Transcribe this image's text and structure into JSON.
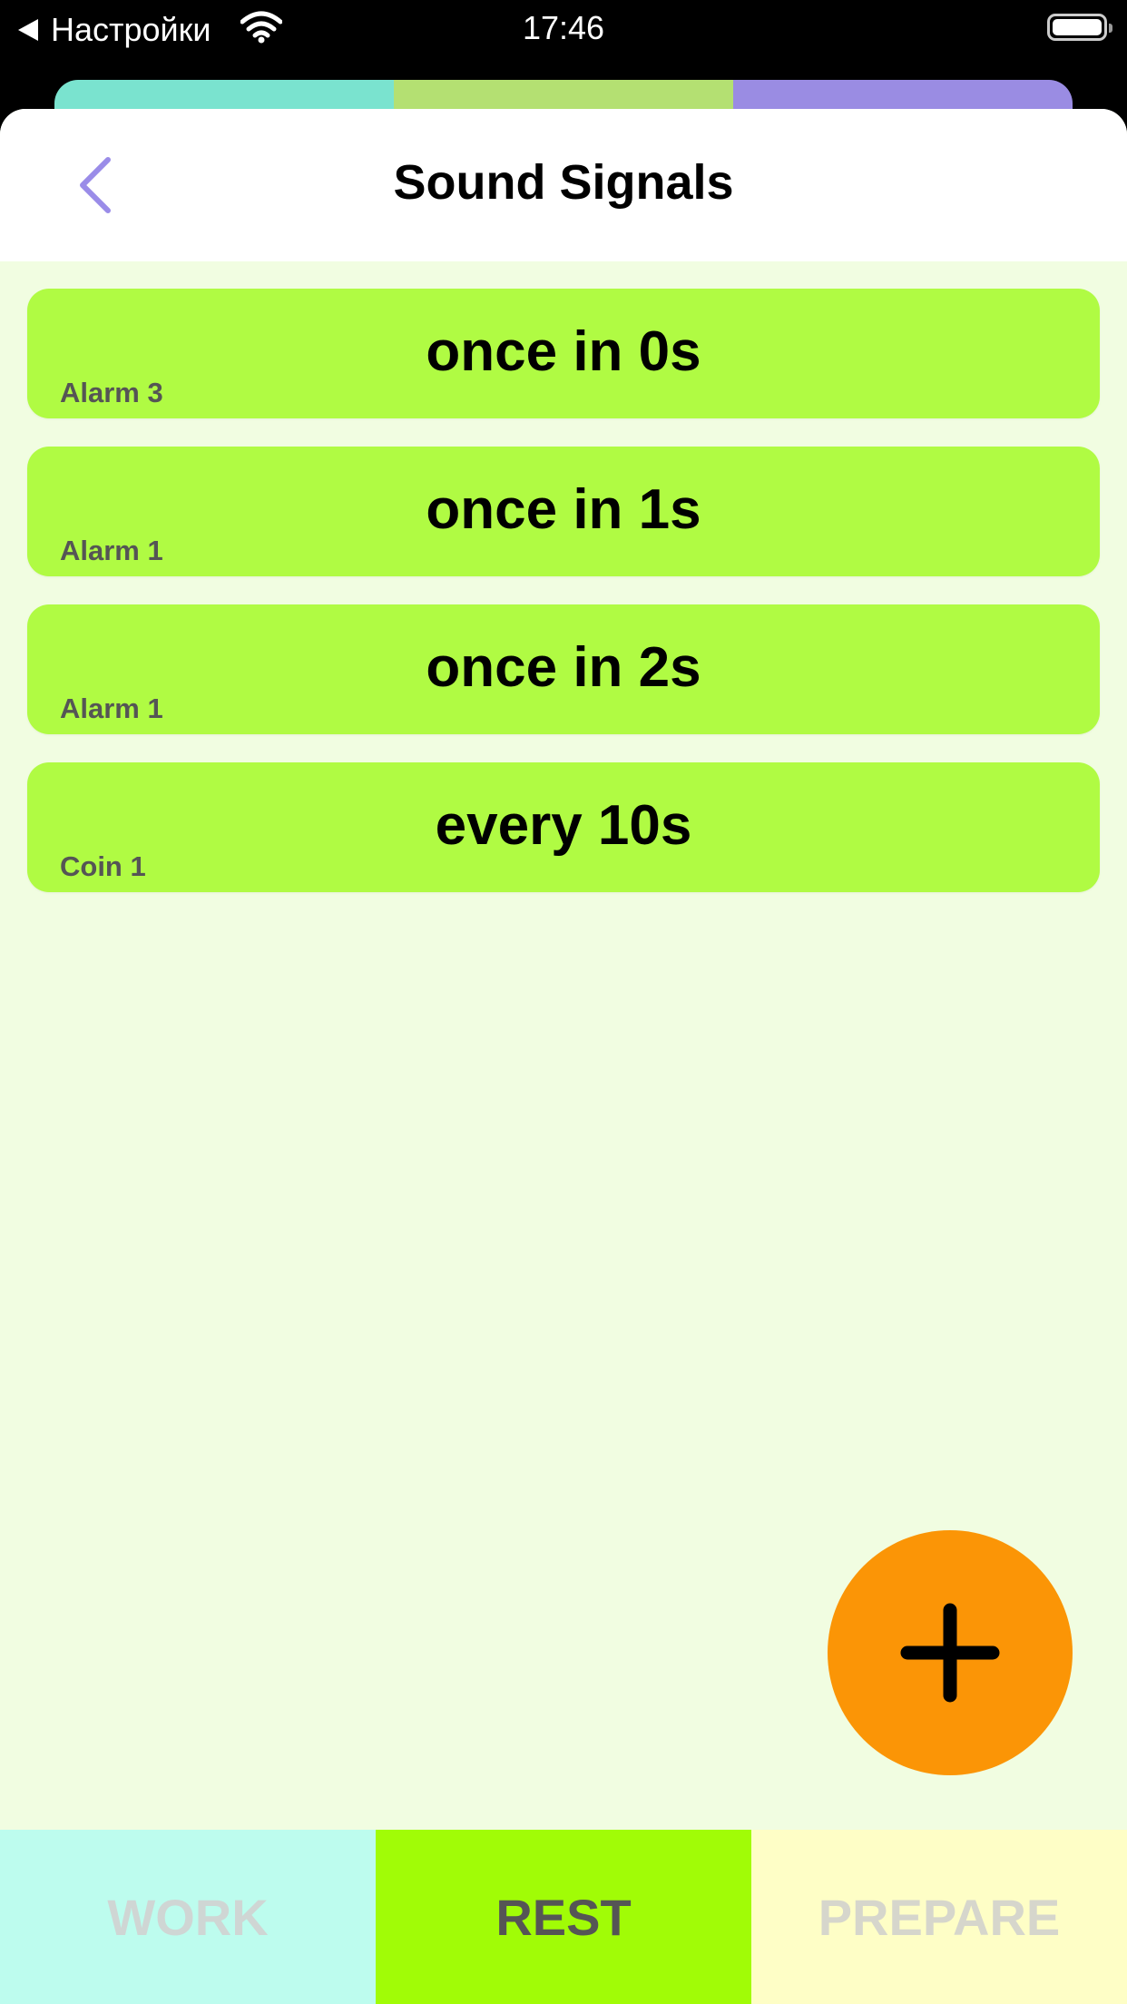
{
  "status_bar": {
    "back_label": "Настройки",
    "time": "17:46"
  },
  "back_sheet_colors": [
    "#7ae3cf",
    "#b4e072",
    "#9a8ce3"
  ],
  "header": {
    "title": "Sound Signals",
    "back_icon": "chevron-left-icon",
    "accent": "#9a8ce8"
  },
  "signals": [
    {
      "when": "once in 0s",
      "sound": "Alarm 3"
    },
    {
      "when": "once in 1s",
      "sound": "Alarm 1"
    },
    {
      "when": "once in 2s",
      "sound": "Alarm 1"
    },
    {
      "when": "every 10s",
      "sound": "Coin 1"
    }
  ],
  "fab": {
    "icon": "plus-icon",
    "color": "#fb9506"
  },
  "tabs": [
    {
      "label": "WORK",
      "color": "#bdfcee"
    },
    {
      "label": "REST",
      "color": "#a1fc06",
      "selected": true
    },
    {
      "label": "PREPARE",
      "color": "#fefec6"
    }
  ]
}
